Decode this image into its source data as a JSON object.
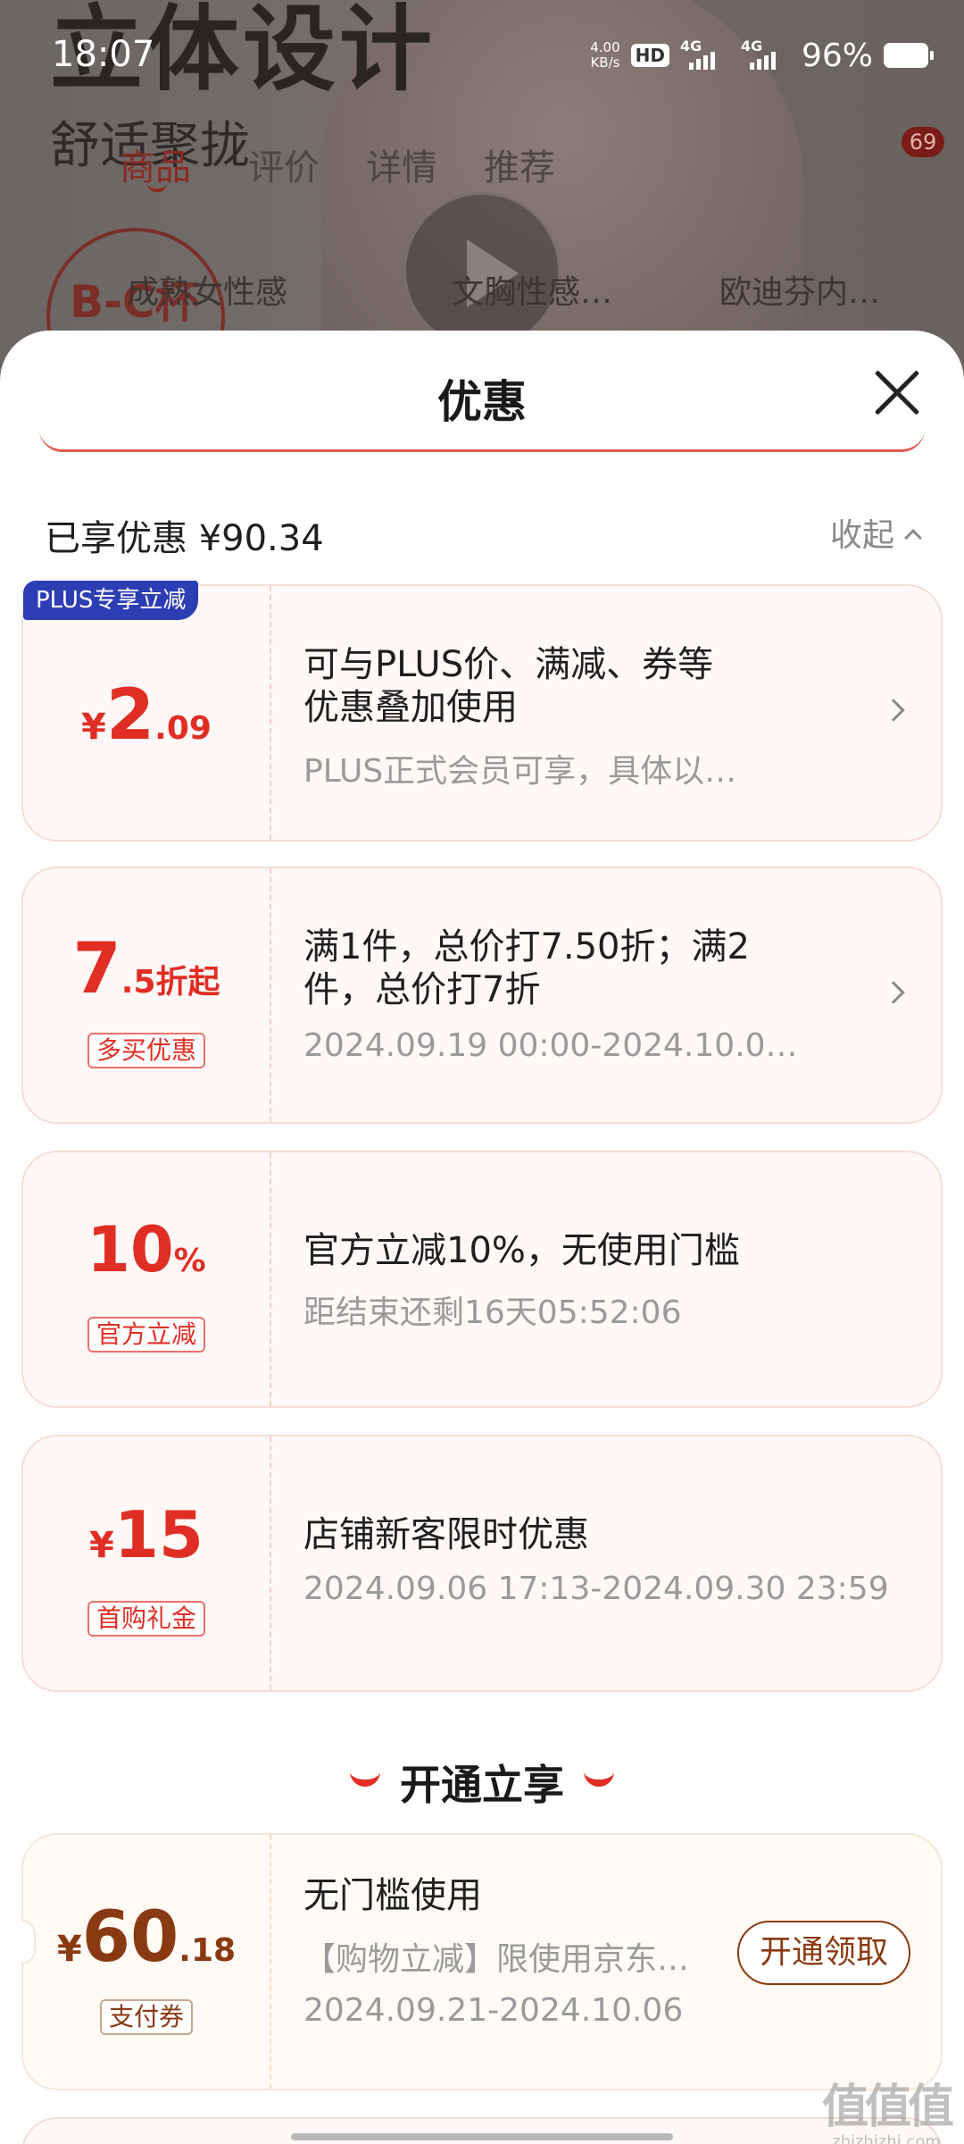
{
  "status_bar": {
    "time": "18:07",
    "net_speed": "4.00",
    "net_unit": "KB/s",
    "hd": "HD",
    "sim1": "4G",
    "sim2": "4G",
    "battery": "96%"
  },
  "background": {
    "headline": "立体设计",
    "subtitle": "舒适聚拢",
    "tabs": [
      "商品",
      "评价",
      "详情",
      "推荐"
    ],
    "badge": "69",
    "cup_label": "B-C杯",
    "chips": [
      "成熟女性感",
      "文胸性感…",
      "欧迪芬内…"
    ]
  },
  "sheet": {
    "title": "优惠",
    "saved_text": "已享优惠 ¥90.34",
    "collapse_label": "收起"
  },
  "offers": [
    {
      "badge": "PLUS专享立减",
      "price_symbol": "¥",
      "price_big": "2",
      "price_small": ".09",
      "line1": "可与PLUS价、满减、券等",
      "line2": "优惠叠加使用",
      "detail": "PLUS正式会员可享，具体以…"
    },
    {
      "price_big": "7",
      "price_small": ".5折起",
      "tag": "多买优惠",
      "line1": "满1件，总价打7.50折；满2",
      "line2": "件，总价打7折",
      "detail": "2024.09.19 00:00-2024.10.0…"
    },
    {
      "price_big": "10",
      "price_small": "%",
      "tag": "官方立减",
      "line1": "官方立减10%，无使用门槛",
      "detail": "距结束还剩16天05:52:06"
    },
    {
      "price_symbol": "¥",
      "price_big": "15",
      "tag": "首购礼金",
      "line1": "店铺新客限时优惠",
      "detail": "2024.09.06 17:13-2024.09.30 23:59"
    }
  ],
  "section": {
    "title": "开通立享"
  },
  "plus_offer": {
    "price_symbol": "¥",
    "price_big": "60",
    "price_small": ".18",
    "tag": "支付券",
    "line1": "无门槛使用",
    "line2": "【购物立减】限使用京东…",
    "detail": "2024.09.21-2024.10.06",
    "cta": "开通领取"
  },
  "watermark": {
    "logo": "值值值",
    "url": "zhizhizhi.com"
  },
  "colors": {
    "accent_red": "#e02e24",
    "plus_blue": "#2d3eb4",
    "gold_brown": "#8a3a12",
    "card_bg": "#fff8f6"
  }
}
